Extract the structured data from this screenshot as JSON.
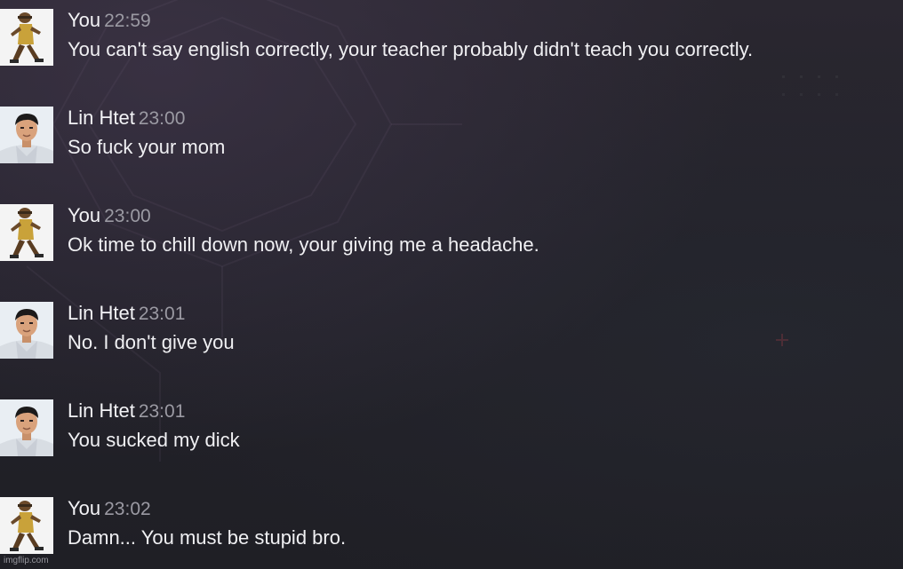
{
  "messages": [
    {
      "author": "You",
      "time": "22:59",
      "text": "You can't say english correctly, your teacher probably didn't teach you correctly.",
      "avatar": "dancing-figure-avatar"
    },
    {
      "author": "Lin Htet",
      "time": "23:00",
      "text": "So fuck your mom",
      "avatar": "person-photo-avatar"
    },
    {
      "author": "You",
      "time": "23:00",
      "text": "Ok time to chill down now, your giving me a headache.",
      "avatar": "dancing-figure-avatar"
    },
    {
      "author": "Lin Htet",
      "time": "23:01",
      "text": "No. I don't give you",
      "avatar": "person-photo-avatar"
    },
    {
      "author": "Lin Htet",
      "time": "23:01",
      "text": "You sucked my dick",
      "avatar": "person-photo-avatar"
    },
    {
      "author": "You",
      "time": "23:02",
      "text": "Damn... You must be stupid bro.",
      "avatar": "dancing-figure-avatar"
    }
  ],
  "watermark": "imgflip.com"
}
